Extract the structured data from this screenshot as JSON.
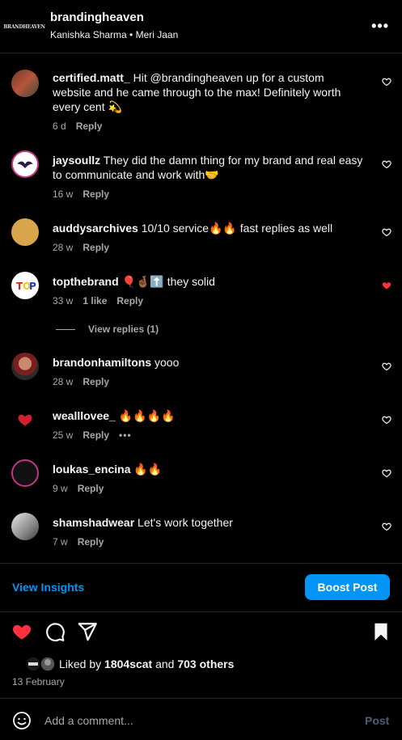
{
  "header": {
    "logo_text": "BRANDHEAVEN",
    "username": "brandingheaven",
    "subtitle": "Kanishka Sharma • Meri Jaan"
  },
  "comments": [
    {
      "user": "certified.matt_",
      "text": " Hit @brandingheaven up for a custom website and he came through to the max! Definitely worth every cent 💫",
      "age": "6 d",
      "likes": "",
      "reply": "Reply",
      "liked": false
    },
    {
      "user": "jaysoullz",
      "text": " They did the damn thing for my brand and real easy to communicate and work with🤝",
      "age": "16 w",
      "likes": "",
      "reply": "Reply",
      "liked": false
    },
    {
      "user": "auddysarchives",
      "text": " 10/10 service🔥🔥 fast replies as well",
      "age": "28 w",
      "likes": "",
      "reply": "Reply",
      "liked": false
    },
    {
      "user": "topthebrand",
      "text": " 🎈🤞🏾⬆️ they solid",
      "age": "33 w",
      "likes": "1 like",
      "reply": "Reply",
      "liked": true
    },
    {
      "user": "brandonhamiltons",
      "text": " yooo",
      "age": "28 w",
      "likes": "",
      "reply": "Reply",
      "liked": false
    },
    {
      "user": "wealllovee_",
      "text": " 🔥🔥🔥🔥",
      "age": "25 w",
      "likes": "",
      "reply": "Reply",
      "liked": false
    },
    {
      "user": "loukas_encina",
      "text": " 🔥🔥",
      "age": "9 w",
      "likes": "",
      "reply": "Reply",
      "liked": false
    },
    {
      "user": "shamshadwear",
      "text": " Let's work together",
      "age": "7 w",
      "likes": "",
      "reply": "Reply",
      "liked": false
    }
  ],
  "view_replies": "View replies (1)",
  "more_dots": "•••",
  "insights_label": "View Insights",
  "boost_label": "Boost Post",
  "likes": {
    "prefix": "Liked by ",
    "user": "1804scat",
    "middle": " and ",
    "others": "703 others"
  },
  "date": "13 February",
  "comment_placeholder": "Add a comment...",
  "post_label": "Post",
  "colors": {
    "accent": "#0095f6",
    "heart": "#ff3040",
    "muted": "#a8a8a8"
  }
}
